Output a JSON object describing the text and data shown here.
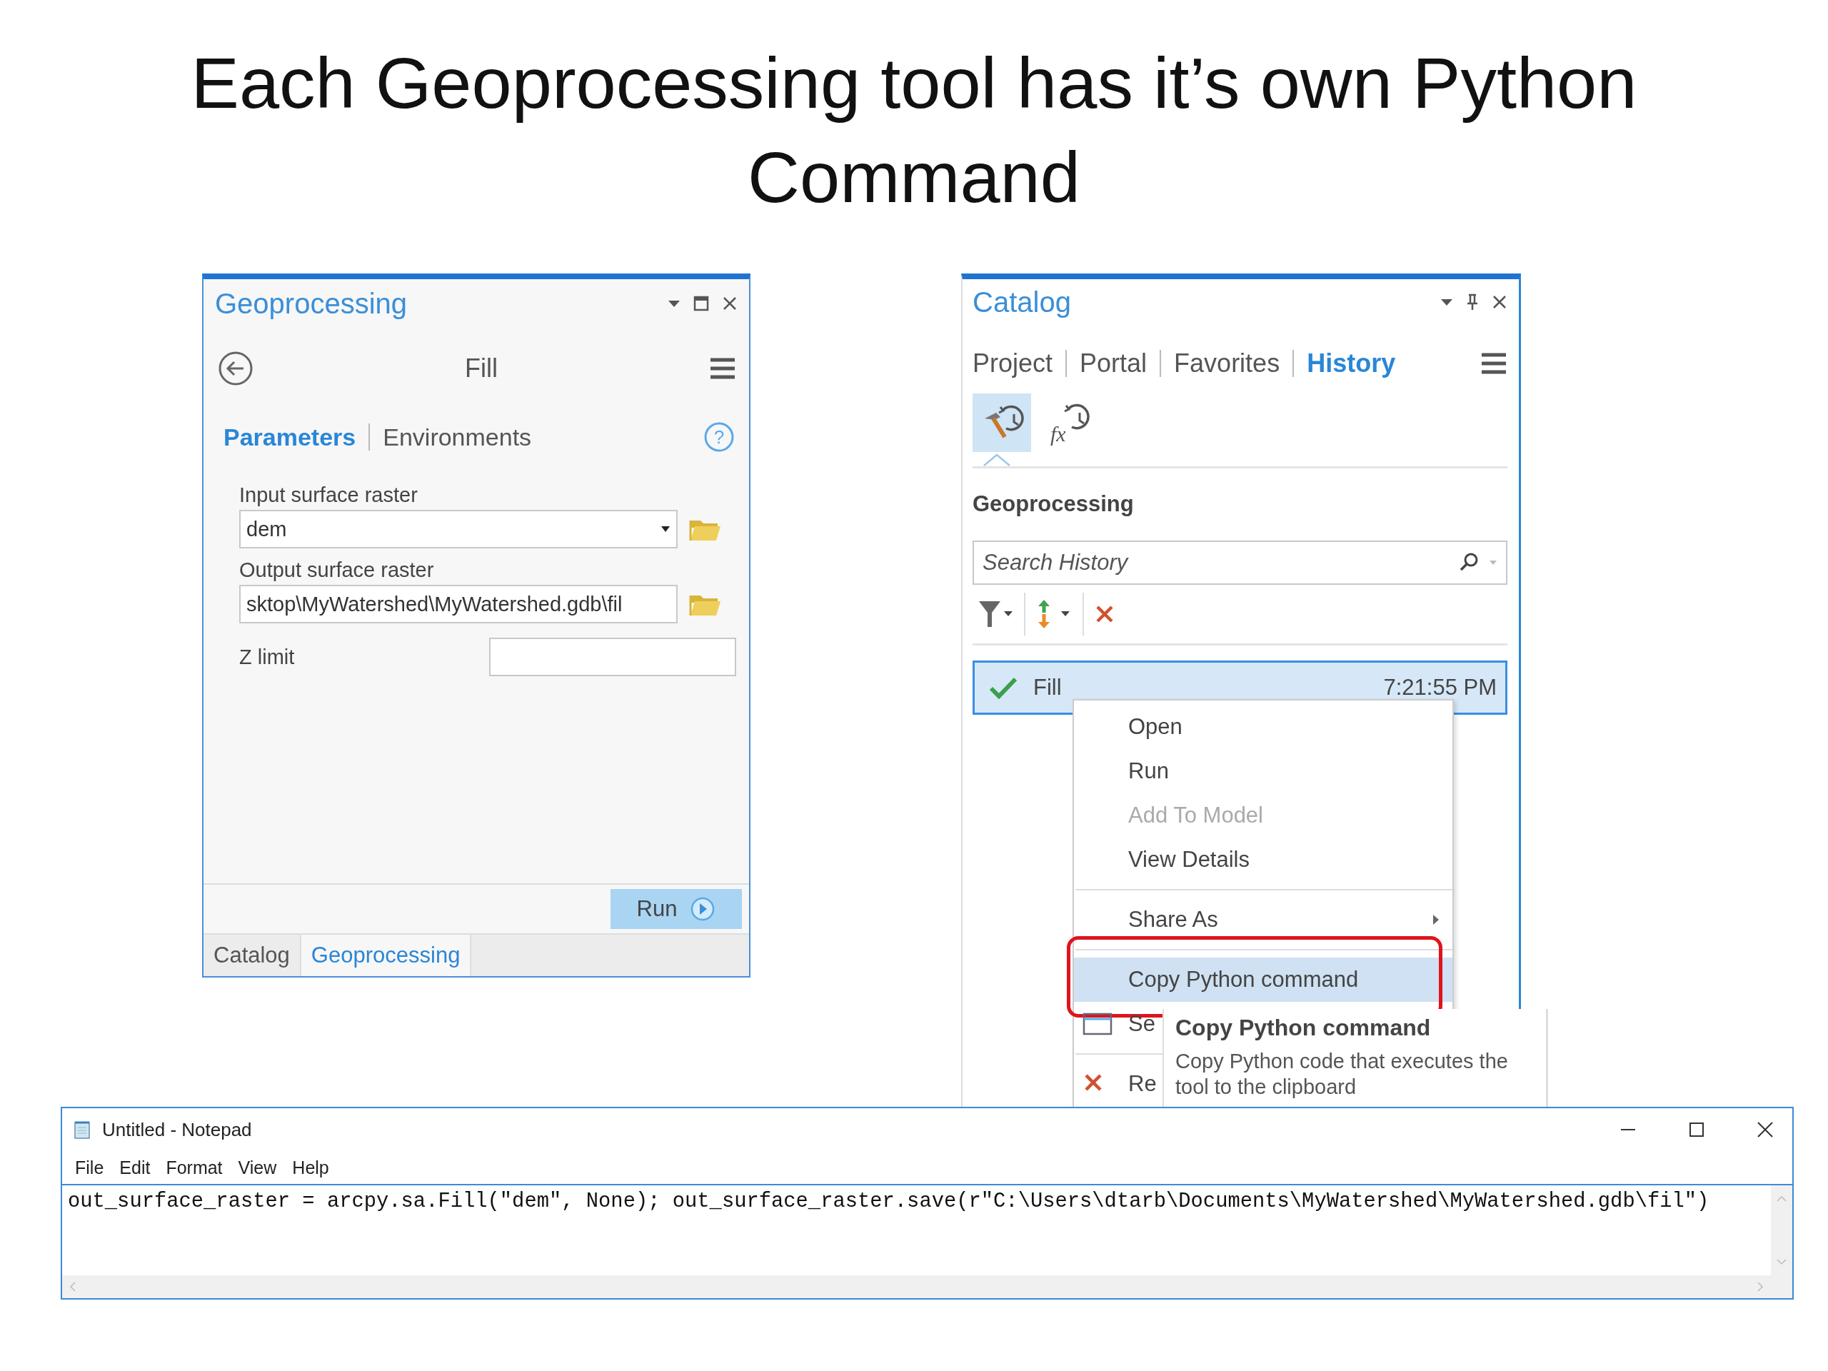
{
  "slide_title": "Each Geoprocessing tool has it’s own Python Command",
  "geoprocessing_pane": {
    "title": "Geoprocessing",
    "tool_name": "Fill",
    "tabs": [
      {
        "label": "Parameters",
        "selected": true
      },
      {
        "label": "Environments",
        "selected": false
      }
    ],
    "help_symbol": "?",
    "parameters": [
      {
        "kind": "dropdown",
        "label": "Input surface raster",
        "value": "dem"
      },
      {
        "kind": "path",
        "label": "Output surface raster",
        "value": "sktop\\MyWatershed\\MyWatershed.gdb\\fil"
      },
      {
        "kind": "inline",
        "label": "Z limit"
      }
    ],
    "run_button": "Run",
    "bottom_tabs": [
      {
        "label": "Catalog",
        "selected": false
      },
      {
        "label": "Geoprocessing",
        "selected": true
      }
    ]
  },
  "catalog_pane": {
    "title": "Catalog",
    "tabs": [
      {
        "label": "Project",
        "selected": false
      },
      {
        "label": "Portal",
        "selected": false
      },
      {
        "label": "Favorites",
        "selected": false
      },
      {
        "label": "History",
        "selected": true
      }
    ],
    "history_views": [
      {
        "kind": "tools",
        "selected": true
      },
      {
        "kind": "functions",
        "symbol": "fx",
        "selected": false
      }
    ],
    "section": "Geoprocessing",
    "search": {
      "placeholder": "Search History"
    },
    "history_items": [
      {
        "name": "Fill",
        "time": "7:21:55 PM",
        "selected": true
      }
    ],
    "context_menu": [
      {
        "kind": "plain",
        "label": "Open",
        "disabled": false,
        "selected": false,
        "separator_before": false,
        "callout": false
      },
      {
        "kind": "plain",
        "label": "Run",
        "disabled": false,
        "selected": false,
        "separator_before": false,
        "callout": false
      },
      {
        "kind": "plain",
        "label": "Add To Model",
        "disabled": true,
        "selected": false,
        "separator_before": false,
        "callout": false
      },
      {
        "kind": "plain",
        "label": "View Details",
        "disabled": false,
        "selected": false,
        "separator_before": false,
        "callout": false
      },
      {
        "kind": "submenu",
        "label": "Share As",
        "disabled": false,
        "selected": false,
        "separator_before": true,
        "callout": false
      },
      {
        "kind": "plain",
        "label": "Copy Python command",
        "disabled": false,
        "selected": true,
        "separator_before": true,
        "callout": true
      },
      {
        "kind": "window",
        "label": "Se",
        "disabled": false,
        "selected": false,
        "separator_before": false,
        "callout": false
      },
      {
        "kind": "delete",
        "label": "Re",
        "disabled": false,
        "selected": false,
        "separator_before": true,
        "callout": false
      }
    ],
    "tooltip": {
      "title": "Copy Python command",
      "text": "Copy Python code that executes the tool to the clipboard"
    }
  },
  "notepad": {
    "title": "Untitled - Notepad",
    "menu": [
      "File",
      "Edit",
      "Format",
      "View",
      "Help"
    ],
    "text": "out_surface_raster = arcpy.sa.Fill(\"dem\", None); out_surface_raster.save(r\"C:\\Users\\dtarb\\Documents\\MyWatershed\\MyWatershed.gdb\\fil\")"
  }
}
